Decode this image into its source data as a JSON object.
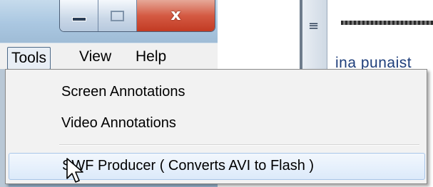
{
  "window": {
    "caption_buttons": {
      "minimize_icon": "minimize-icon",
      "maximize_icon": "maximize-icon",
      "close_icon": "close-icon",
      "close_glyph": "x"
    }
  },
  "menubar": {
    "items": [
      {
        "label": "Tools",
        "active": true
      },
      {
        "label": "View"
      },
      {
        "label": "Help"
      }
    ]
  },
  "background_document": {
    "visible_text": "ina punaist"
  },
  "dropdown": {
    "items": [
      {
        "label": "Screen Annotations"
      },
      {
        "label": "Video Annotations"
      },
      {
        "label": "SWF Producer ( Converts AVI to Flash )",
        "highlighted": true
      }
    ]
  },
  "colors": {
    "titlebar": "#aac7e1",
    "close_button": "#d45a43",
    "menu_highlight": "#dceafa",
    "doc_text": "#1d3d7a"
  }
}
